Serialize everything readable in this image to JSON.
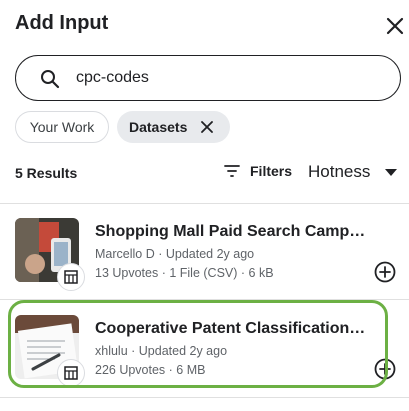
{
  "dialog": {
    "title": "Add Input",
    "close_icon": "close-icon"
  },
  "search": {
    "value": "cpc-codes",
    "placeholder": "",
    "icon": "search-icon"
  },
  "chips": {
    "your_work": "Your Work",
    "datasets": "Datasets"
  },
  "results": {
    "count_label": "5 Results",
    "filters_label": "Filters",
    "sort_label": "Hotness"
  },
  "items": [
    {
      "title": "Shopping Mall Paid Search Camp…",
      "meta1": "Marcello D · Updated 2y ago",
      "meta2": "13 Upvotes · 1 File (CSV) · 6 kB"
    },
    {
      "title": "Cooperative Patent Classification…",
      "meta1": "xhlulu · Updated 2y ago",
      "meta2": "226 Upvotes · 6 MB"
    }
  ],
  "colors": {
    "highlight": "#6cb044",
    "text": "#202124",
    "muted": "#5f6368"
  }
}
